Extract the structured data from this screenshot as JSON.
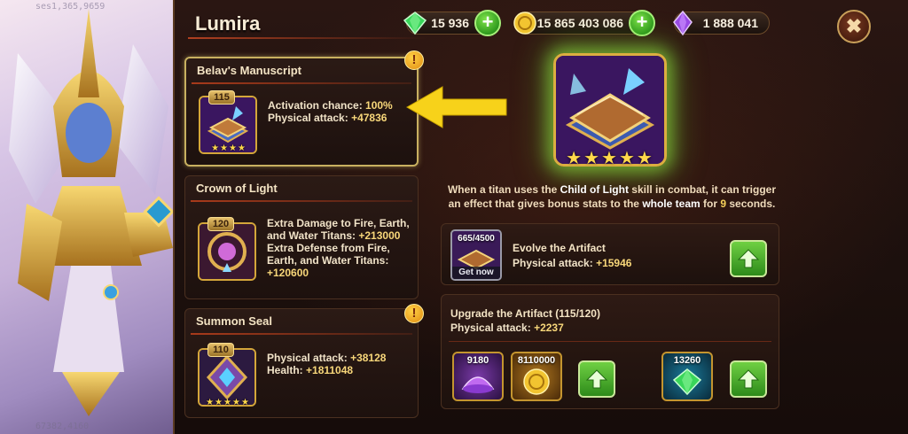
{
  "hero": {
    "top_id": "ses1,365,9659",
    "bottom_id": "67382,4160"
  },
  "header": {
    "title": "Lumira",
    "close_label": "✖"
  },
  "currencies": [
    {
      "name": "emeralds",
      "icon": "emerald-icon",
      "value": "15 936",
      "has_plus": true
    },
    {
      "name": "gold",
      "icon": "gold-coin-icon",
      "value": "15 865 403 086",
      "has_plus": true
    },
    {
      "name": "titan-crystals",
      "icon": "purple-crystal-icon",
      "value": "1 888 041",
      "has_plus": false
    }
  ],
  "artifacts": [
    {
      "title": "Belav's Manuscript",
      "level": "115",
      "stars": "★★★★",
      "lines": [
        {
          "label": "Activation chance: ",
          "value": "100%"
        },
        {
          "label": "Physical attack: ",
          "value": "+47836"
        }
      ],
      "alert": "!"
    },
    {
      "title": "Crown of Light",
      "level": "120",
      "stars": "",
      "lines": [
        {
          "label": "Extra Damage to Fire, Earth,",
          "value": ""
        },
        {
          "label": "and Water Titans: ",
          "value": "+213000"
        },
        {
          "label": "Extra Defense from Fire,",
          "value": ""
        },
        {
          "label": "Earth, and Water Titans:",
          "value": ""
        },
        {
          "label": "",
          "value": "+120600"
        }
      ]
    },
    {
      "title": "Summon Seal",
      "level": "110",
      "stars": "★★★★★",
      "lines": [
        {
          "label": "Physical attack: ",
          "value": "+38128"
        },
        {
          "label": "Health: ",
          "value": "+1811048"
        }
      ],
      "alert": "!"
    }
  ],
  "selected": {
    "stars": "★★★★★",
    "description": {
      "p1": "When a titan uses the ",
      "skill": "Child of Light",
      "p2": " skill in combat, it can trigger an effect that gives bonus stats to the ",
      "team": "whole team",
      "p3": " for ",
      "secs": "9",
      "p4": " seconds."
    }
  },
  "evolve": {
    "progress": "665/4500",
    "get_now": "Get now",
    "title": "Evolve the Artifact",
    "stat_label": "Physical attack: ",
    "stat_value": "+15946"
  },
  "upgrade": {
    "title": "Upgrade the Artifact (115/120)",
    "stat_label": "Physical attack: ",
    "stat_value": "+2237",
    "resources": [
      {
        "name": "titan-potion",
        "icon": "purple-potion-icon",
        "count": "9180"
      },
      {
        "name": "gold",
        "icon": "gold-coins-icon",
        "count": "8110000"
      },
      {
        "name": "emerald",
        "icon": "emerald-icon",
        "count": "13260"
      }
    ]
  },
  "colors": {
    "accent_gold": "#f8d77a",
    "green_button": "#2d8a1a",
    "panel_bg": "#1d110e",
    "highlight_glow": "#96f046"
  }
}
